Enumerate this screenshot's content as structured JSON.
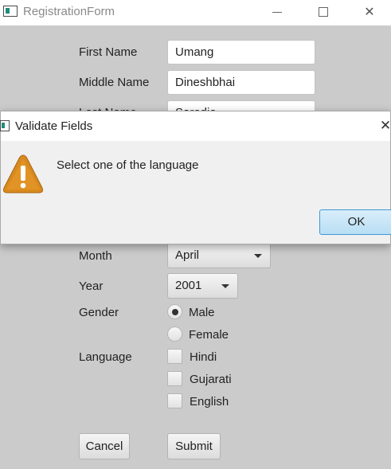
{
  "window": {
    "title": "RegistrationForm",
    "close_glyph": "✕"
  },
  "form": {
    "first_name": {
      "label": "First Name",
      "value": "Umang"
    },
    "middle_name": {
      "label": "Middle Name",
      "value": "Dineshbhai"
    },
    "last_name": {
      "label": "Last Name",
      "value": "Sarodia"
    },
    "month": {
      "label": "Month",
      "value": "April"
    },
    "year": {
      "label": "Year",
      "value": "2001"
    },
    "gender": {
      "label": "Gender",
      "options": [
        {
          "label": "Male",
          "selected": true
        },
        {
          "label": "Female",
          "selected": false
        }
      ]
    },
    "language": {
      "label": "Language",
      "options": [
        {
          "label": "Hindi",
          "checked": false
        },
        {
          "label": "Gujarati",
          "checked": false
        },
        {
          "label": "English",
          "checked": false
        }
      ]
    },
    "cancel_label": "Cancel",
    "submit_label": "Submit"
  },
  "dialog": {
    "title": "Validate Fields",
    "message": "Select one of the language",
    "ok_label": "OK",
    "close_glyph": "✕",
    "icon": "warning-icon",
    "icon_color": "#d88a1e"
  }
}
